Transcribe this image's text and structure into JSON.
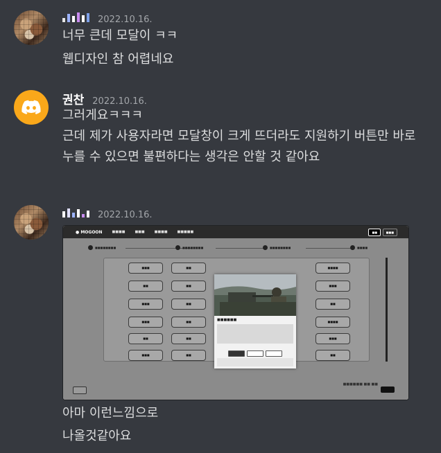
{
  "messages": [
    {
      "author": "",
      "avatar": "pixelated-user-avatar",
      "timestamp": "2022.10.16.",
      "lines": [
        "너무 큰데 모달이 ㅋㅋ",
        "웹디자인 참 어렵네요"
      ]
    },
    {
      "author": "권찬",
      "avatar": "discord-logo-icon",
      "avatar_color": "#faa81a",
      "timestamp": "2022.10.16.",
      "lines": [
        "그러게요ㅋㅋㅋ",
        "근데 제가 사용자라면 모달창이 크게 뜨더라도 지원하기 버튼만 바로 누를 수 있으면 불편하다는 생각은 안할 것 같아요"
      ]
    },
    {
      "author": "",
      "avatar": "pixelated-user-avatar",
      "timestamp": "2022.10.16.",
      "attachment": "website-modal-screenshot",
      "lines": [
        "아마 이런느낌으로",
        "나올것같아요"
      ]
    }
  ],
  "colors": {
    "background": "#36393f",
    "text": "#dcddde",
    "author": "#ffffff",
    "timestamp": "#a3a6aa",
    "discord_orange": "#faa81a"
  }
}
